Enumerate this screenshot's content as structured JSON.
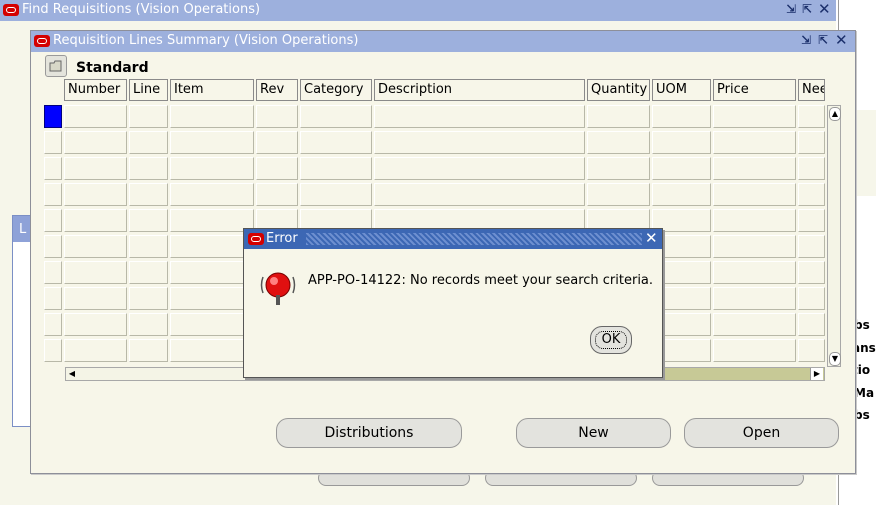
{
  "find_window": {
    "title": "Find Requisitions (Vision Operations)",
    "partial_label_L": "L",
    "right_fragments": [
      "bs",
      "ans",
      "tio",
      "Ma",
      "bs"
    ]
  },
  "summary_window": {
    "title": "Requisition Lines Summary (Vision Operations)",
    "folder_name": "Standard",
    "columns": [
      "Number",
      "Line",
      "Item",
      "Rev",
      "Category",
      "Description",
      "Quantity",
      "UOM",
      "Price",
      "Nee"
    ],
    "buttons": {
      "distributions": "Distributions",
      "new": "New",
      "open": "Open"
    }
  },
  "error_dialog": {
    "title": "Error",
    "message": "APP-PO-14122: No records meet your search criteria.",
    "ok_label": "OK"
  },
  "colors": {
    "titlebar_inactive": "#9db0dd",
    "titlebar_active": "#3c67b4",
    "oracle_red": "#d40000",
    "window_bg": "#f7f6e9",
    "current_record": "#0000ff"
  }
}
